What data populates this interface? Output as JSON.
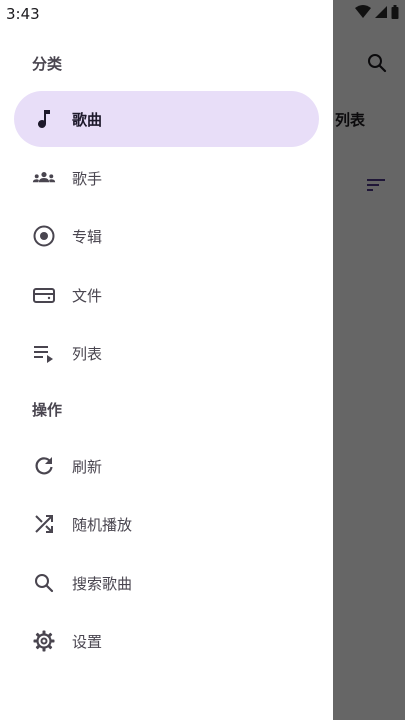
{
  "status_bar": {
    "time": "3:43"
  },
  "background_app": {
    "label": "列表",
    "search_icon": "search-icon",
    "sort_icon": "sort-icon"
  },
  "drawer": {
    "categories_title": "分类",
    "categories": [
      {
        "label": "歌曲",
        "icon": "music-note-icon",
        "active": true
      },
      {
        "label": "歌手",
        "icon": "people-icon",
        "active": false
      },
      {
        "label": "专辑",
        "icon": "album-icon",
        "active": false
      },
      {
        "label": "文件",
        "icon": "folder-icon",
        "active": false
      },
      {
        "label": "列表",
        "icon": "playlist-icon",
        "active": false
      }
    ],
    "actions_title": "操作",
    "actions": [
      {
        "label": "刷新",
        "icon": "refresh-icon"
      },
      {
        "label": "随机播放",
        "icon": "shuffle-icon"
      },
      {
        "label": "搜索歌曲",
        "icon": "search-icon"
      },
      {
        "label": "设置",
        "icon": "gear-icon"
      }
    ]
  },
  "colors": {
    "active_bg": "#e8def8",
    "text": "#49454f",
    "scrim": "#666666"
  }
}
